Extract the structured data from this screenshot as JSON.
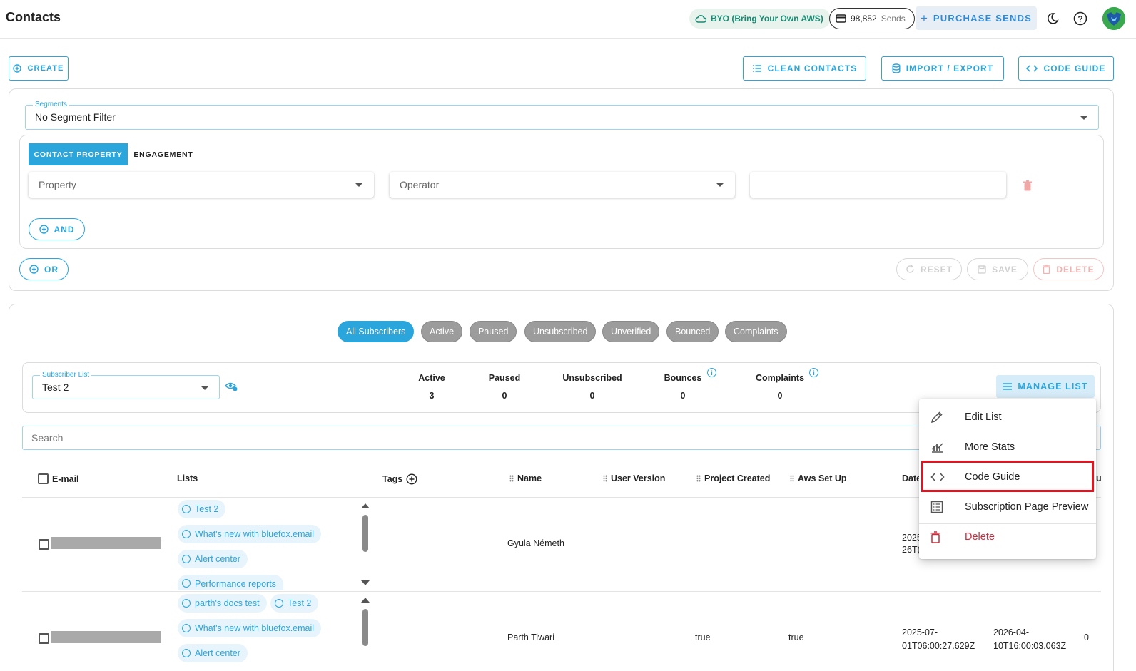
{
  "header": {
    "title": "Contacts",
    "byo_label": "BYO (Bring Your Own AWS)",
    "sends_count": "98,852",
    "sends_label": "Sends",
    "purchase_label": "PURCHASE SENDS"
  },
  "toolbar": {
    "create_label": "CREATE",
    "clean_label": "CLEAN CONTACTS",
    "import_export_label": "IMPORT / EXPORT",
    "code_guide_label": "CODE GUIDE"
  },
  "filters": {
    "segments_legend": "Segments",
    "segments_value": "No Segment Filter",
    "tabs": [
      {
        "label": "CONTACT PROPERTY",
        "active": true
      },
      {
        "label": "ENGAGEMENT",
        "active": false
      }
    ],
    "property_placeholder": "Property",
    "operator_placeholder": "Operator",
    "value": "",
    "and_label": "AND",
    "or_label": "OR",
    "reset_label": "RESET",
    "save_label": "SAVE",
    "delete_label": "DELETE"
  },
  "status_filters": [
    {
      "label": "All Subscribers",
      "active": true
    },
    {
      "label": "Active",
      "active": false
    },
    {
      "label": "Paused",
      "active": false
    },
    {
      "label": "Unsubscribed",
      "active": false
    },
    {
      "label": "Unverified",
      "active": false
    },
    {
      "label": "Bounced",
      "active": false
    },
    {
      "label": "Complaints",
      "active": false
    }
  ],
  "subscriber_list": {
    "legend": "Subscriber List",
    "value": "Test 2",
    "stats": [
      {
        "label": "Active",
        "value": "3"
      },
      {
        "label": "Paused",
        "value": "0"
      },
      {
        "label": "Unsubscribed",
        "value": "0"
      },
      {
        "label": "Bounces",
        "value": "0"
      },
      {
        "label": "Complaints",
        "value": "0"
      }
    ],
    "manage_label": "MANAGE LIST"
  },
  "search": {
    "placeholder": "Search"
  },
  "table": {
    "columns": [
      "E-mail",
      "Lists",
      "Tags",
      "Name",
      "User Version",
      "Project Created",
      "Aws Set Up",
      "Date"
    ],
    "rows": [
      {
        "lists": [
          "Test 2",
          "What's new with bluefox.email",
          "Alert center",
          "Performance reports"
        ],
        "name": "Gyula Németh",
        "user_version": "",
        "project_created": "",
        "aws_set_up": "",
        "date_part1": "2025",
        "date_part2": "26T("
      },
      {
        "lists": [
          "parth's docs test",
          "Test 2",
          "What's new with bluefox.email",
          "Alert center"
        ],
        "name": "Parth Tiwari",
        "user_version": "",
        "project_created": "true",
        "aws_set_up": "true",
        "date_part1": "2025-07-",
        "date_part2": "01T06:00:27.629Z",
        "date2_part1": "2026-04-",
        "date2_part2": "10T16:00:03.063Z",
        "extra": "0"
      }
    ]
  },
  "menu": {
    "items": [
      {
        "label": "Edit List",
        "icon": "pencil-icon"
      },
      {
        "label": "More Stats",
        "icon": "stats-icon"
      },
      {
        "label": "Code Guide",
        "icon": "code-icon"
      },
      {
        "label": "Subscription Page Preview",
        "icon": "preview-icon"
      },
      {
        "label": "Delete",
        "icon": "trash-icon"
      }
    ]
  },
  "colors": {
    "accent": "#2aa6dd",
    "highlight": "#e5121f",
    "danger": "#cc2b3c",
    "byo_green": "#1a8a72"
  }
}
